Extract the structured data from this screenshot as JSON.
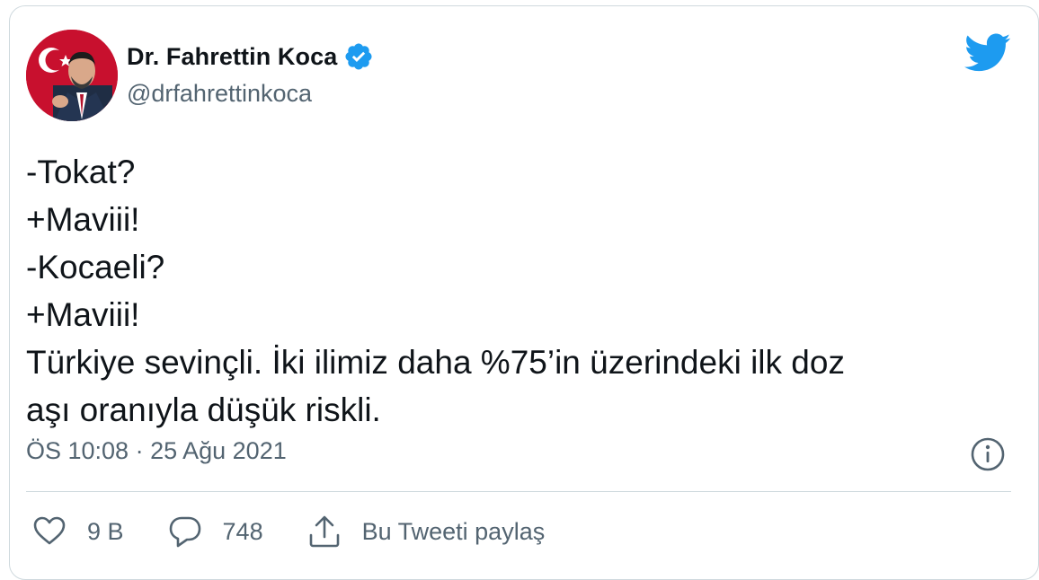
{
  "author": {
    "display_name": "Dr. Fahrettin Koca",
    "handle": "@drfahrettinkoca",
    "verified": true
  },
  "tweet": {
    "lines": [
      "-Tokat?",
      "+Maviii!",
      "-Kocaeli?",
      "+Maviii!",
      "Türkiye sevinçli. İki ilimiz daha %75’in üzerindeki ilk doz",
      "aşı oranıyla düşük riskli."
    ],
    "timestamp": "ÖS 10:08 · 25 Ağu 2021"
  },
  "actions": {
    "likes": "9 B",
    "replies": "748",
    "share_label": "Bu Tweeti paylaş"
  },
  "colors": {
    "text": "#0f1419",
    "secondary": "#536471",
    "twitter_blue": "#1d9bf0",
    "border": "#cfd9de"
  },
  "icons": {
    "brand": "twitter-bird-icon",
    "verified": "verified-badge-icon",
    "info": "info-icon",
    "like": "heart-icon",
    "reply": "reply-bubble-icon",
    "share": "share-icon"
  }
}
